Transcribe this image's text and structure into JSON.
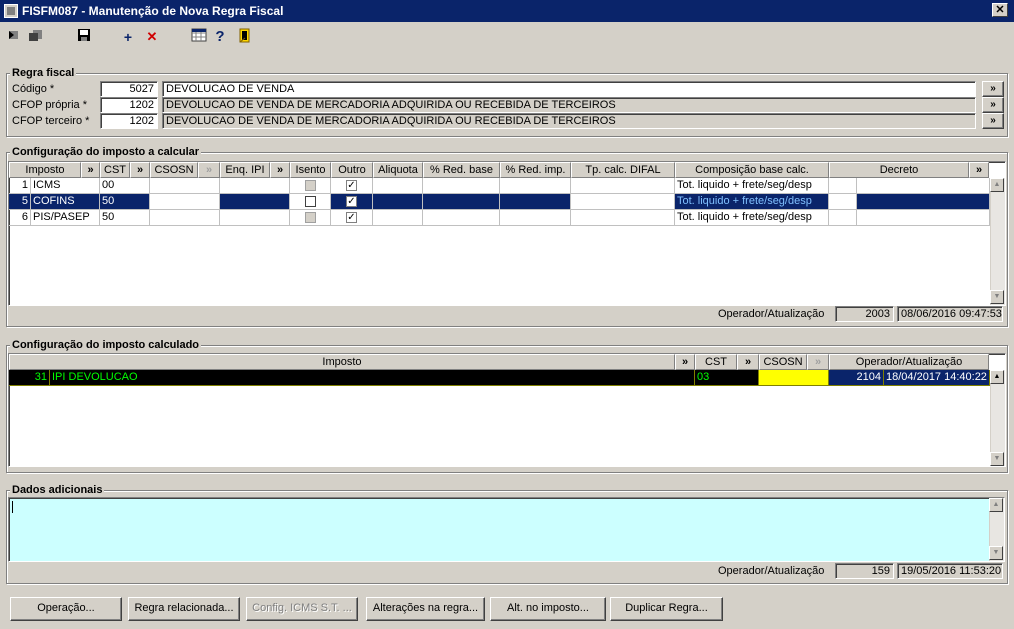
{
  "window": {
    "title": "FISFM087 - Manutenção de Nova Regra Fiscal",
    "close_label": "✕"
  },
  "toolbar": {
    "icons": [
      "first-icon",
      "previous-icon",
      "save-icon",
      "add-icon",
      "delete-icon",
      "grid-icon",
      "help-icon",
      "exit-icon"
    ],
    "add_glyph": "+",
    "delete_glyph": "✕",
    "help_glyph": "?"
  },
  "regra_fiscal": {
    "title": "Regra fiscal",
    "codigo_label": "Código *",
    "codigo_value": "5027",
    "codigo_desc": "DEVOLUCAO DE VENDA",
    "cfop_propria_label": "CFOP própria *",
    "cfop_propria_value": "1202",
    "cfop_propria_desc": "DEVOLUCAO DE VENDA DE MERCADORIA ADQUIRIDA OU RECEBIDA DE TERCEIROS",
    "cfop_terceiro_label": "CFOP terceiro *",
    "cfop_terceiro_value": "1202",
    "cfop_terceiro_desc": "DEVOLUCAO DE VENDA DE MERCADORIA ADQUIRIDA OU RECEBIDA DE TERCEIROS",
    "lookup_label": "»"
  },
  "impostos_calcular": {
    "title": "Configuração do imposto a calcular",
    "headers": {
      "imposto": "Imposto",
      "cst": "CST",
      "csosn": "CSOSN",
      "enq_ipi": "Enq. IPI",
      "isento": "Isento",
      "outro": "Outro",
      "aliquota": "Aliquota",
      "red_base": "% Red. base",
      "red_imp": "% Red. imp.",
      "tp_calc": "Tp. calc. DIFAL",
      "composicao": "Composição base calc.",
      "decreto": "Decreto",
      "more": "»"
    },
    "rows": [
      {
        "num": "1",
        "imposto": "ICMS",
        "cst": "00",
        "composicao": "Tot. liquido + frete/seg/desp",
        "isento": false,
        "outro": true
      },
      {
        "num": "5",
        "imposto": "COFINS",
        "cst": "50",
        "composicao": "Tot. liquido + frete/seg/desp",
        "isento": false,
        "outro": true
      },
      {
        "num": "6",
        "imposto": "PIS/PASEP",
        "cst": "50",
        "composicao": "Tot. liquido + frete/seg/desp",
        "isento": false,
        "outro": true
      }
    ],
    "selected_row": 1,
    "operador_label": "Operador/Atualização",
    "operador_value": "2003",
    "atualizacao_value": "08/06/2016 09:47:53"
  },
  "imposto_calculado": {
    "title": "Configuração do imposto calculado",
    "headers": {
      "imposto": "Imposto",
      "cst": "CST",
      "csosn": "CSOSN",
      "operador": "Operador/Atualização",
      "more": "»"
    },
    "rows": [
      {
        "num": "31",
        "imposto": "IPI DEVOLUCAO",
        "cst": "03",
        "csosn": "",
        "operador": "2104",
        "atualizacao": "18/04/2017 14:40:22"
      }
    ]
  },
  "dados_adicionais": {
    "title": "Dados adicionais",
    "value": "",
    "operador_label": "Operador/Atualização",
    "operador_value": "159",
    "atualizacao_value": "19/05/2016 11:53:20"
  },
  "buttons": {
    "operacao": "Operação...",
    "regra_relacionada": "Regra relacionada...",
    "config_icms": "Config. ICMS S.T. ...",
    "alteracoes": "Alterações na regra...",
    "alt_imposto": "Alt. no imposto...",
    "duplicar": "Duplicar Regra..."
  },
  "colors": {
    "title_bar": "#0a246a",
    "selection": "#0a246a",
    "calc_row": "#000000",
    "calc_text": "#00ff00",
    "csosn_highlight": "#ffff00",
    "notes_bg": "#ccffff"
  }
}
